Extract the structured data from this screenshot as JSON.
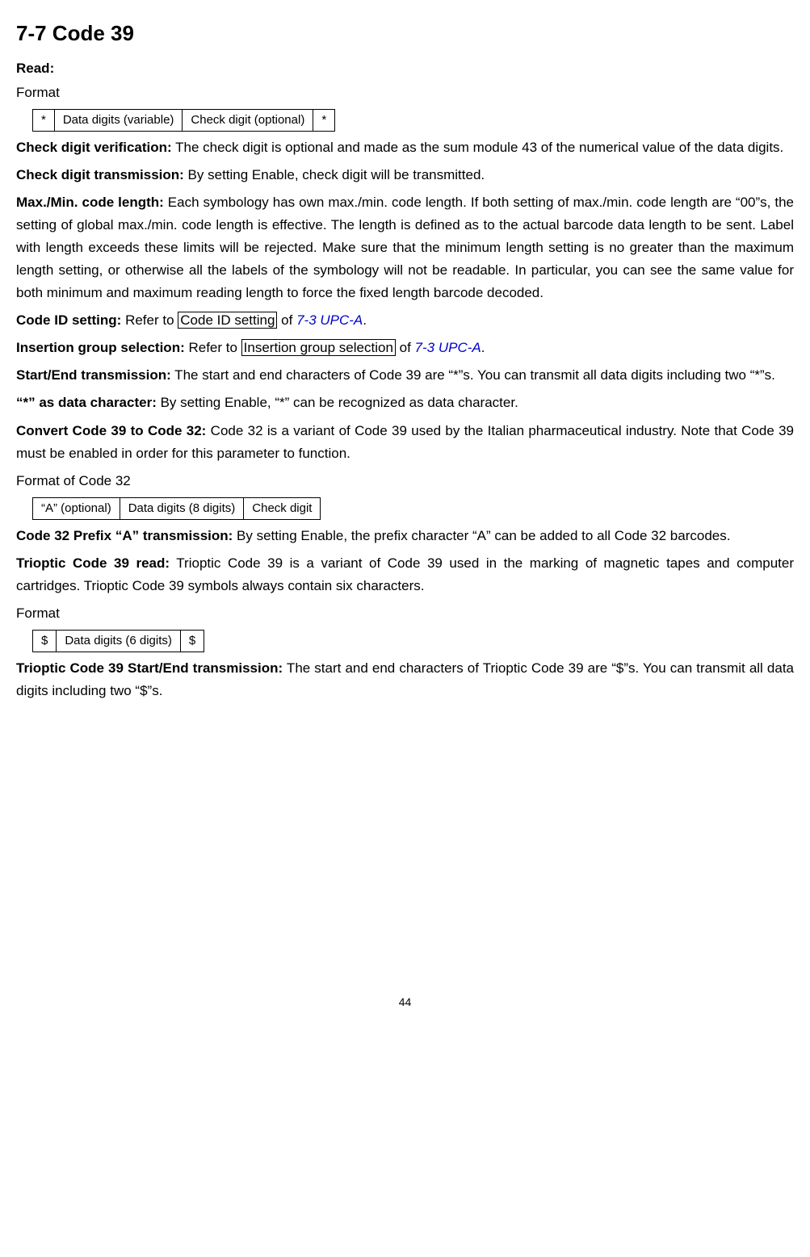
{
  "title": "7-7 Code 39",
  "read": "Read:",
  "format_label": "Format",
  "fmt1": {
    "a": "*",
    "b": "Data digits (variable)",
    "c": "Check digit (optional)",
    "d": "*"
  },
  "para": {
    "cdv_label": "Check digit verification:",
    "cdv_text": " The check digit is optional and made as the sum module 43 of the numerical value of the data digits.",
    "cdt_label": "Check digit transmission:",
    "cdt_text": " By setting Enable, check digit will be transmitted.",
    "mm_label": "Max./Min. code length:",
    "mm_text": " Each symbology has own max./min. code length. If both setting of max./min. code length are “00”s, the setting of global max./min. code length is effective. The length is defined as to the actual barcode data length to be sent. Label with length exceeds these limits will be rejected. Make sure that the minimum length setting is no greater than the maximum length setting, or otherwise all the labels of the symbology will not be readable. In particular, you can see the same value for both minimum and maximum reading length to force the fixed length barcode decoded.",
    "cid_label": "Code ID setting:",
    "cid_pre": " Refer to ",
    "cid_box": "Code ID setting",
    "cid_mid": " of ",
    "cid_ref": "7-3 UPC-A",
    "cid_end": ".",
    "igs_label": "Insertion group selection:",
    "igs_pre": " Refer to ",
    "igs_box": "Insertion group selection",
    "igs_mid": " of ",
    "igs_ref": "7-3 UPC-A",
    "igs_end": ".",
    "set_label": "Start/End transmission:",
    "set_text": " The start and end characters of Code 39 are “*”s. You can transmit all data digits including two “*”s.",
    "asdc_label": "“*” as data character:",
    "asdc_text": " By setting Enable, “*” can be recognized as data character.",
    "c32_label": "Convert Code 39 to Code 32:",
    "c32_text": " Code 32 is a variant of Code 39 used by the Italian pharmaceutical industry. Note that Code 39 must be enabled in order for this parameter to function.",
    "fc32_label": "Format of Code 32",
    "c32p_label": "Code 32 Prefix “A” transmission:",
    "c32p_text": " By setting Enable, the prefix character “A” can be added to all Code 32 barcodes.",
    "tc_label": "Trioptic Code 39 read:",
    "tc_text": " Trioptic Code 39 is a variant of Code 39 used in the marking of magnetic tapes and computer cartridges. Trioptic Code 39 symbols always contain six characters.",
    "tse_label": "Trioptic Code 39 Start/End transmission:",
    "tse_text": " The start and end characters of Trioptic Code 39 are “$”s. You can transmit all data digits including two “$”s."
  },
  "fmt2": {
    "a": "“A” (optional)",
    "b": "Data digits (8 digits)",
    "c": "Check digit"
  },
  "fmt3": {
    "a": "$",
    "b": "Data digits (6 digits)",
    "c": "$"
  },
  "page": "44"
}
